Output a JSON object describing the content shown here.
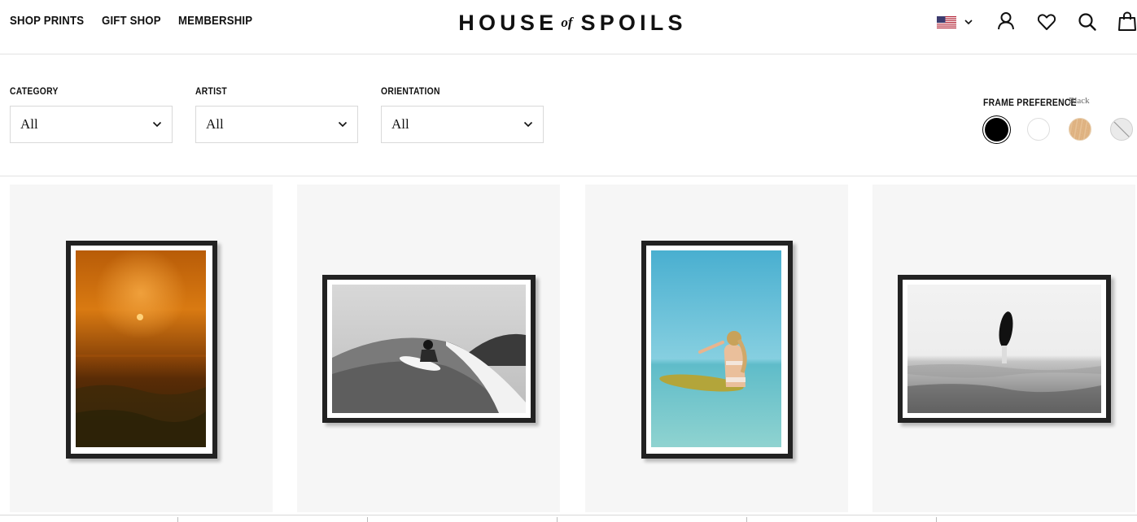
{
  "header": {
    "nav": [
      "SHOP PRINTS",
      "GIFT SHOP",
      "MEMBERSHIP"
    ],
    "logo_left": "HOUSE",
    "logo_of": "of",
    "logo_right": "SPOILS",
    "icons": [
      "us-flag-icon",
      "chevron-down-icon",
      "account-icon",
      "heart-icon",
      "search-icon",
      "bag-icon"
    ]
  },
  "filters": {
    "category": {
      "label": "CATEGORY",
      "value": "All"
    },
    "artist": {
      "label": "ARTIST",
      "value": "All"
    },
    "orientation": {
      "label": "ORIENTATION",
      "value": "All"
    },
    "frame_preference": {
      "label": "FRAME PREFERENCE",
      "current": "Black",
      "options": [
        "Black",
        "White",
        "Oak",
        "No Frame"
      ]
    }
  },
  "products": [
    {
      "image": "sunset-ocean-photo",
      "orientation": "portrait"
    },
    {
      "image": "black-white-surfer-photo",
      "orientation": "landscape"
    },
    {
      "image": "surfer-girl-photo",
      "orientation": "portrait"
    },
    {
      "image": "black-surfboard-photo",
      "orientation": "landscape"
    }
  ],
  "colors": {
    "text": "#111111",
    "card_bg": "#f6f6f6",
    "frame": "#222222",
    "border": "#e3e3e3"
  }
}
